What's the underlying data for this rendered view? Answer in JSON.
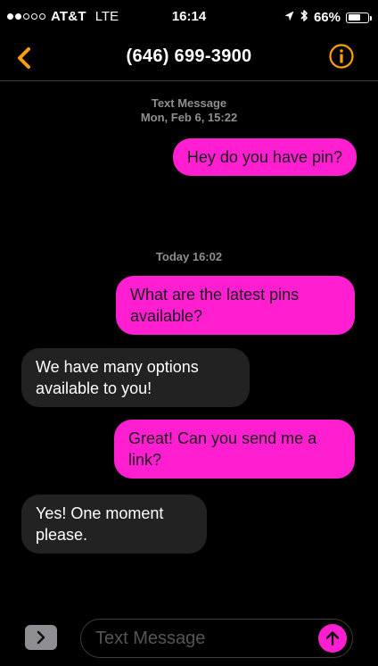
{
  "status_bar": {
    "carrier": "AT&T",
    "network": "LTE",
    "time": "16:14",
    "battery_percent_label": "66%",
    "battery_level": 0.66
  },
  "nav": {
    "title": "(646) 699-3900",
    "back_icon": "chevron-left-icon",
    "info_icon": "info-icon"
  },
  "colors": {
    "accent": "#ff9f0a",
    "outgoing_bubble": "#ff1fd0",
    "incoming_bubble": "#222222"
  },
  "thread": {
    "header_1": {
      "line1": "Text Message",
      "line2": "Mon, Feb 6, 15:22"
    },
    "header_2": "Today 16:02",
    "messages": [
      {
        "direction": "out",
        "text": "Hey do you have pin?"
      },
      {
        "direction": "out",
        "text": "What are the latest pins available?"
      },
      {
        "direction": "in",
        "text": "We have many options available to you!"
      },
      {
        "direction": "out",
        "text": "Great! Can you send me a link?"
      },
      {
        "direction": "in",
        "text": "Yes! One moment please."
      }
    ]
  },
  "input": {
    "placeholder": "Text Message",
    "apps_icon": "chevron-right-icon",
    "send_icon": "arrow-up-icon"
  }
}
